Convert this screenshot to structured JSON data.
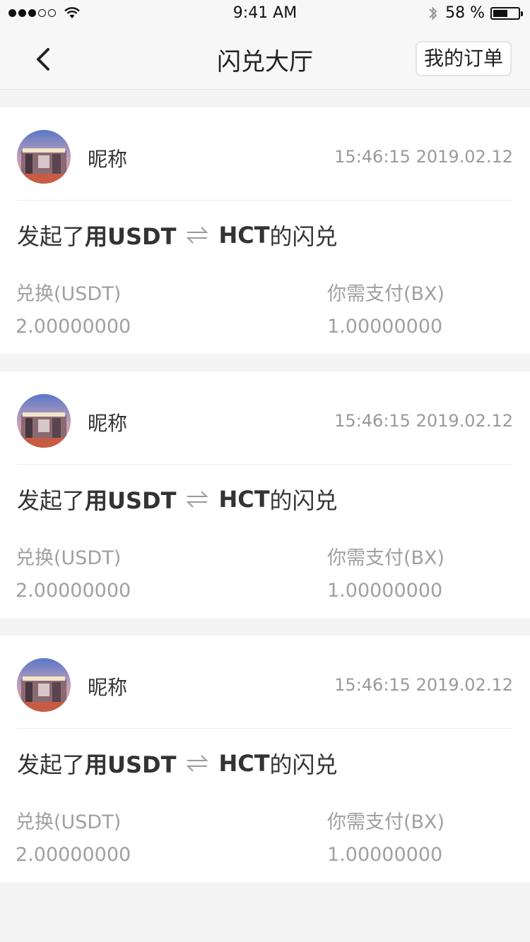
{
  "status": {
    "time": "9:41 AM",
    "battery_text": "58 %",
    "battery_level": 0.58,
    "signal_bars": 3,
    "signal_total": 5
  },
  "nav": {
    "title": "闪兑大厅",
    "orders_button": "我的订单"
  },
  "orders": [
    {
      "nickname": "昵称",
      "time": "15:46:15 2019.02.12",
      "prefix": "发起了",
      "bold_prefix": "用USDT",
      "target": "HCT",
      "suffix": "的闪兑",
      "left_label": "兑换(USDT)",
      "left_value": "2.00000000",
      "right_label": "你需支付(BX)",
      "right_value": "1.00000000"
    },
    {
      "nickname": "昵称",
      "time": "15:46:15 2019.02.12",
      "prefix": "发起了",
      "bold_prefix": "用USDT",
      "target": "HCT",
      "suffix": "的闪兑",
      "left_label": "兑换(USDT)",
      "left_value": "2.00000000",
      "right_label": "你需支付(BX)",
      "right_value": "1.00000000"
    },
    {
      "nickname": "昵称",
      "time": "15:46:15 2019.02.12",
      "prefix": "发起了",
      "bold_prefix": "用USDT",
      "target": "HCT",
      "suffix": "的闪兑",
      "left_label": "兑换(USDT)",
      "left_value": "2.00000000",
      "right_label": "你需支付(BX)",
      "right_value": "1.00000000"
    }
  ],
  "icons": {
    "back": "chevron-left-icon",
    "swap": "swap-arrows-icon",
    "avatar": "avatar-image"
  }
}
